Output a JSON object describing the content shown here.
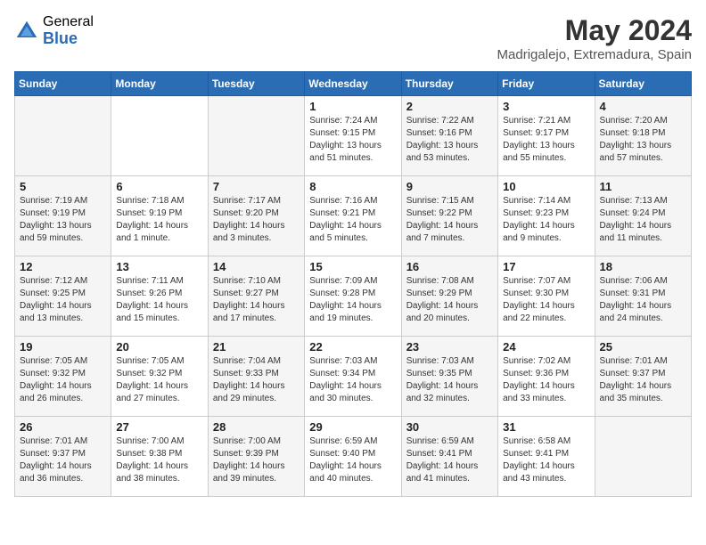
{
  "header": {
    "logo_general": "General",
    "logo_blue": "Blue",
    "title": "May 2024",
    "subtitle": "Madrigalejo, Extremadura, Spain"
  },
  "columns": [
    "Sunday",
    "Monday",
    "Tuesday",
    "Wednesday",
    "Thursday",
    "Friday",
    "Saturday"
  ],
  "weeks": [
    {
      "days": [
        {
          "num": "",
          "detail": ""
        },
        {
          "num": "",
          "detail": ""
        },
        {
          "num": "",
          "detail": ""
        },
        {
          "num": "1",
          "detail": "Sunrise: 7:24 AM\nSunset: 9:15 PM\nDaylight: 13 hours\nand 51 minutes."
        },
        {
          "num": "2",
          "detail": "Sunrise: 7:22 AM\nSunset: 9:16 PM\nDaylight: 13 hours\nand 53 minutes."
        },
        {
          "num": "3",
          "detail": "Sunrise: 7:21 AM\nSunset: 9:17 PM\nDaylight: 13 hours\nand 55 minutes."
        },
        {
          "num": "4",
          "detail": "Sunrise: 7:20 AM\nSunset: 9:18 PM\nDaylight: 13 hours\nand 57 minutes."
        }
      ]
    },
    {
      "days": [
        {
          "num": "5",
          "detail": "Sunrise: 7:19 AM\nSunset: 9:19 PM\nDaylight: 13 hours\nand 59 minutes."
        },
        {
          "num": "6",
          "detail": "Sunrise: 7:18 AM\nSunset: 9:19 PM\nDaylight: 14 hours\nand 1 minute."
        },
        {
          "num": "7",
          "detail": "Sunrise: 7:17 AM\nSunset: 9:20 PM\nDaylight: 14 hours\nand 3 minutes."
        },
        {
          "num": "8",
          "detail": "Sunrise: 7:16 AM\nSunset: 9:21 PM\nDaylight: 14 hours\nand 5 minutes."
        },
        {
          "num": "9",
          "detail": "Sunrise: 7:15 AM\nSunset: 9:22 PM\nDaylight: 14 hours\nand 7 minutes."
        },
        {
          "num": "10",
          "detail": "Sunrise: 7:14 AM\nSunset: 9:23 PM\nDaylight: 14 hours\nand 9 minutes."
        },
        {
          "num": "11",
          "detail": "Sunrise: 7:13 AM\nSunset: 9:24 PM\nDaylight: 14 hours\nand 11 minutes."
        }
      ]
    },
    {
      "days": [
        {
          "num": "12",
          "detail": "Sunrise: 7:12 AM\nSunset: 9:25 PM\nDaylight: 14 hours\nand 13 minutes."
        },
        {
          "num": "13",
          "detail": "Sunrise: 7:11 AM\nSunset: 9:26 PM\nDaylight: 14 hours\nand 15 minutes."
        },
        {
          "num": "14",
          "detail": "Sunrise: 7:10 AM\nSunset: 9:27 PM\nDaylight: 14 hours\nand 17 minutes."
        },
        {
          "num": "15",
          "detail": "Sunrise: 7:09 AM\nSunset: 9:28 PM\nDaylight: 14 hours\nand 19 minutes."
        },
        {
          "num": "16",
          "detail": "Sunrise: 7:08 AM\nSunset: 9:29 PM\nDaylight: 14 hours\nand 20 minutes."
        },
        {
          "num": "17",
          "detail": "Sunrise: 7:07 AM\nSunset: 9:30 PM\nDaylight: 14 hours\nand 22 minutes."
        },
        {
          "num": "18",
          "detail": "Sunrise: 7:06 AM\nSunset: 9:31 PM\nDaylight: 14 hours\nand 24 minutes."
        }
      ]
    },
    {
      "days": [
        {
          "num": "19",
          "detail": "Sunrise: 7:05 AM\nSunset: 9:32 PM\nDaylight: 14 hours\nand 26 minutes."
        },
        {
          "num": "20",
          "detail": "Sunrise: 7:05 AM\nSunset: 9:32 PM\nDaylight: 14 hours\nand 27 minutes."
        },
        {
          "num": "21",
          "detail": "Sunrise: 7:04 AM\nSunset: 9:33 PM\nDaylight: 14 hours\nand 29 minutes."
        },
        {
          "num": "22",
          "detail": "Sunrise: 7:03 AM\nSunset: 9:34 PM\nDaylight: 14 hours\nand 30 minutes."
        },
        {
          "num": "23",
          "detail": "Sunrise: 7:03 AM\nSunset: 9:35 PM\nDaylight: 14 hours\nand 32 minutes."
        },
        {
          "num": "24",
          "detail": "Sunrise: 7:02 AM\nSunset: 9:36 PM\nDaylight: 14 hours\nand 33 minutes."
        },
        {
          "num": "25",
          "detail": "Sunrise: 7:01 AM\nSunset: 9:37 PM\nDaylight: 14 hours\nand 35 minutes."
        }
      ]
    },
    {
      "days": [
        {
          "num": "26",
          "detail": "Sunrise: 7:01 AM\nSunset: 9:37 PM\nDaylight: 14 hours\nand 36 minutes."
        },
        {
          "num": "27",
          "detail": "Sunrise: 7:00 AM\nSunset: 9:38 PM\nDaylight: 14 hours\nand 38 minutes."
        },
        {
          "num": "28",
          "detail": "Sunrise: 7:00 AM\nSunset: 9:39 PM\nDaylight: 14 hours\nand 39 minutes."
        },
        {
          "num": "29",
          "detail": "Sunrise: 6:59 AM\nSunset: 9:40 PM\nDaylight: 14 hours\nand 40 minutes."
        },
        {
          "num": "30",
          "detail": "Sunrise: 6:59 AM\nSunset: 9:41 PM\nDaylight: 14 hours\nand 41 minutes."
        },
        {
          "num": "31",
          "detail": "Sunrise: 6:58 AM\nSunset: 9:41 PM\nDaylight: 14 hours\nand 43 minutes."
        },
        {
          "num": "",
          "detail": ""
        }
      ]
    }
  ]
}
